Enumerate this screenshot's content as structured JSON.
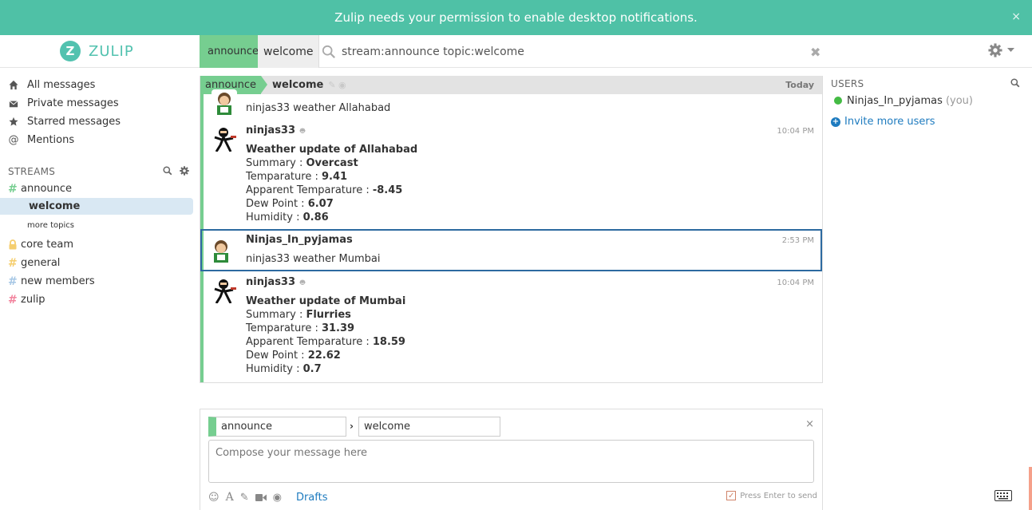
{
  "banner": {
    "text": "Zulip needs your permission to enable desktop notifications.",
    "close": "×"
  },
  "header": {
    "logo_letter": "Z",
    "logo_text": "ZULIP",
    "narrow_stream": "announce",
    "narrow_topic": "welcome",
    "search_value": "stream:announce topic:welcome",
    "search_clear": "✖"
  },
  "sidebar": {
    "nav": [
      {
        "label": "All messages",
        "icon": "home-icon"
      },
      {
        "label": "Private messages",
        "icon": "envelope-icon"
      },
      {
        "label": "Starred messages",
        "icon": "star-icon"
      },
      {
        "label": "Mentions",
        "icon": "at-icon"
      }
    ],
    "streams_heading": "STREAMS",
    "streams": [
      {
        "name": "announce",
        "color": "#76ce90",
        "hash": "#"
      },
      {
        "name": "core team",
        "color": "#f5ce6e",
        "hash": "🔒"
      },
      {
        "name": "general",
        "color": "#f5ce6e",
        "hash": "#"
      },
      {
        "name": "new members",
        "color": "#a6c7e5",
        "hash": "#"
      },
      {
        "name": "zulip",
        "color": "#f2839d",
        "hash": "#"
      }
    ],
    "active_topic": "welcome",
    "more_topics": "more topics"
  },
  "recipient": {
    "stream": "announce",
    "topic": "welcome",
    "date": "Today"
  },
  "messages": [
    {
      "partial": true,
      "text": "ninjas33 weather Allahabad"
    },
    {
      "sender": "ninjas33",
      "time": "10:04 PM",
      "title": "Weather update of Allahabad",
      "rows": [
        {
          "label": "Summary : ",
          "value": "Overcast"
        },
        {
          "label": "Temparature : ",
          "value": "9.41"
        },
        {
          "label": "Apparent Temparature : ",
          "value": "-8.45"
        },
        {
          "label": "Dew Point : ",
          "value": "6.07"
        },
        {
          "label": "Humidity : ",
          "value": "0.86"
        }
      ]
    },
    {
      "sender": "Ninjas_In_pyjamas",
      "time": "2:53 PM",
      "text": "ninjas33 weather Mumbai"
    },
    {
      "sender": "ninjas33",
      "time": "10:04 PM",
      "title": "Weather update of Mumbai",
      "rows": [
        {
          "label": "Summary : ",
          "value": "Flurries"
        },
        {
          "label": "Temparature : ",
          "value": "31.39"
        },
        {
          "label": "Apparent Temparature : ",
          "value": "18.59"
        },
        {
          "label": "Dew Point : ",
          "value": "22.62"
        },
        {
          "label": "Humidity : ",
          "value": "0.7"
        }
      ]
    }
  ],
  "compose": {
    "stream": "announce",
    "arrow": "›",
    "topic": "welcome",
    "placeholder": "Compose your message here",
    "close": "×",
    "drafts": "Drafts",
    "enter_to_send": "Press Enter to send",
    "enter_checked": "✓"
  },
  "users": {
    "heading": "USERS",
    "list": [
      {
        "name": "Ninjas_In_pyjamas",
        "suffix": "(you)",
        "status": "active"
      }
    ],
    "invite": "Invite more users",
    "invite_icon": "+"
  },
  "colors": {
    "banner": "#4fc1a6",
    "brand": "#52c2af",
    "announce": "#76ce90",
    "link": "#1e7bbf",
    "selected_border": "#2d6aa0"
  }
}
